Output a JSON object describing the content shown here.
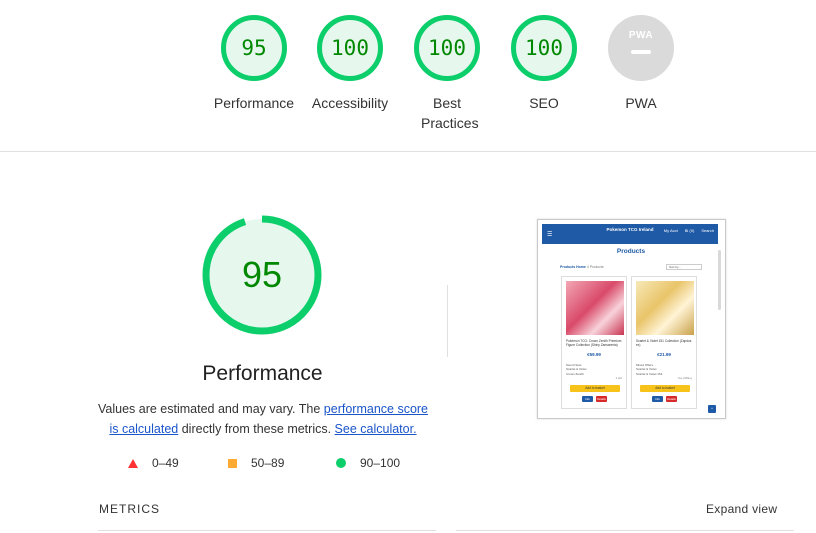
{
  "colors": {
    "pass": "#0cce6b",
    "pass_text": "#008800",
    "pass_bg": "#e6f7ee",
    "average": "#ffaa33",
    "fail": "#ff3333",
    "link": "#1a55c9",
    "brand": "#1f5aa6"
  },
  "categories": [
    {
      "score": "95",
      "label": "Performance",
      "level": 0.95
    },
    {
      "score": "100",
      "label": "Accessibility",
      "level": 1.0
    },
    {
      "score": "100",
      "label": "Best Practices",
      "level": 1.0
    },
    {
      "score": "100",
      "label": "SEO",
      "level": 1.0
    },
    {
      "logo": "PWA",
      "label": "PWA",
      "icon": "pwa-badge-icon"
    }
  ],
  "performance": {
    "score": "95",
    "level": 0.95,
    "title": "Performance",
    "desc_prefix": "Values are estimated and may vary. The ",
    "desc_link1": "performance score is calculated",
    "desc_middle": " directly from these metrics. ",
    "desc_link2": "See calculator."
  },
  "legend": [
    {
      "icon": "fail-triangle-icon",
      "range": "0–49"
    },
    {
      "icon": "average-square-icon",
      "range": "50–89"
    },
    {
      "icon": "pass-circle-icon",
      "range": "90–100"
    }
  ],
  "screenshot": {
    "site_title": "Pokemon TCG Ireland",
    "header_icons": [
      "My Acct",
      "Bl (0)",
      "Search"
    ],
    "menu_icon": "hamburger-icon",
    "heading": "Products",
    "breadcrumb_home": "Products Home",
    "breadcrumb_count": "4 Products",
    "sort_label": "Sort by...",
    "cards": [
      {
        "name": "Pokémon TCG: Crown Zenith Premium Figure Collection (Shiny Zamazenta)",
        "price": "€59.99",
        "features": [
          "Sword Sets",
          "Scarlet & Violet",
          "Crown Zenith"
        ],
        "stock": "1 left",
        "add": "Add to basket",
        "btn1": "Info",
        "btn2": "Details"
      },
      {
        "name": "Scarlet & Violet 151 Collection (Zapdos ex)",
        "price": "€21.99",
        "features": [
          "Mixed Offers",
          "Scarlet & Violet",
          "Scarlet & Violet 151"
        ],
        "stock": "Yes (999+)",
        "add": "Add to basket",
        "btn1": "Info",
        "btn2": "Details"
      }
    ]
  },
  "metrics": {
    "label": "METRICS",
    "expand": "Expand view"
  }
}
